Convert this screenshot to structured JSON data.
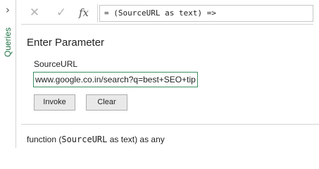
{
  "queries_pane": {
    "label": "Queries",
    "expand_icon": "chevron-right-icon"
  },
  "formula_bar": {
    "cancel_icon": "✕",
    "confirm_icon": "✓",
    "fx_icon": "fx",
    "formula": "= (SourceURL as text) =>"
  },
  "parameter": {
    "title": "Enter Parameter",
    "field_label": "SourceURL",
    "field_value": "www.google.co.in/search?q=best+SEO+tips",
    "invoke_label": "Invoke",
    "clear_label": "Clear"
  },
  "signature": {
    "prefix": "function (",
    "param": "SourceURL",
    "suffix": " as text) as any"
  },
  "colors": {
    "accent_green": "#217346",
    "input_focus_border": "#3c8f5f"
  }
}
